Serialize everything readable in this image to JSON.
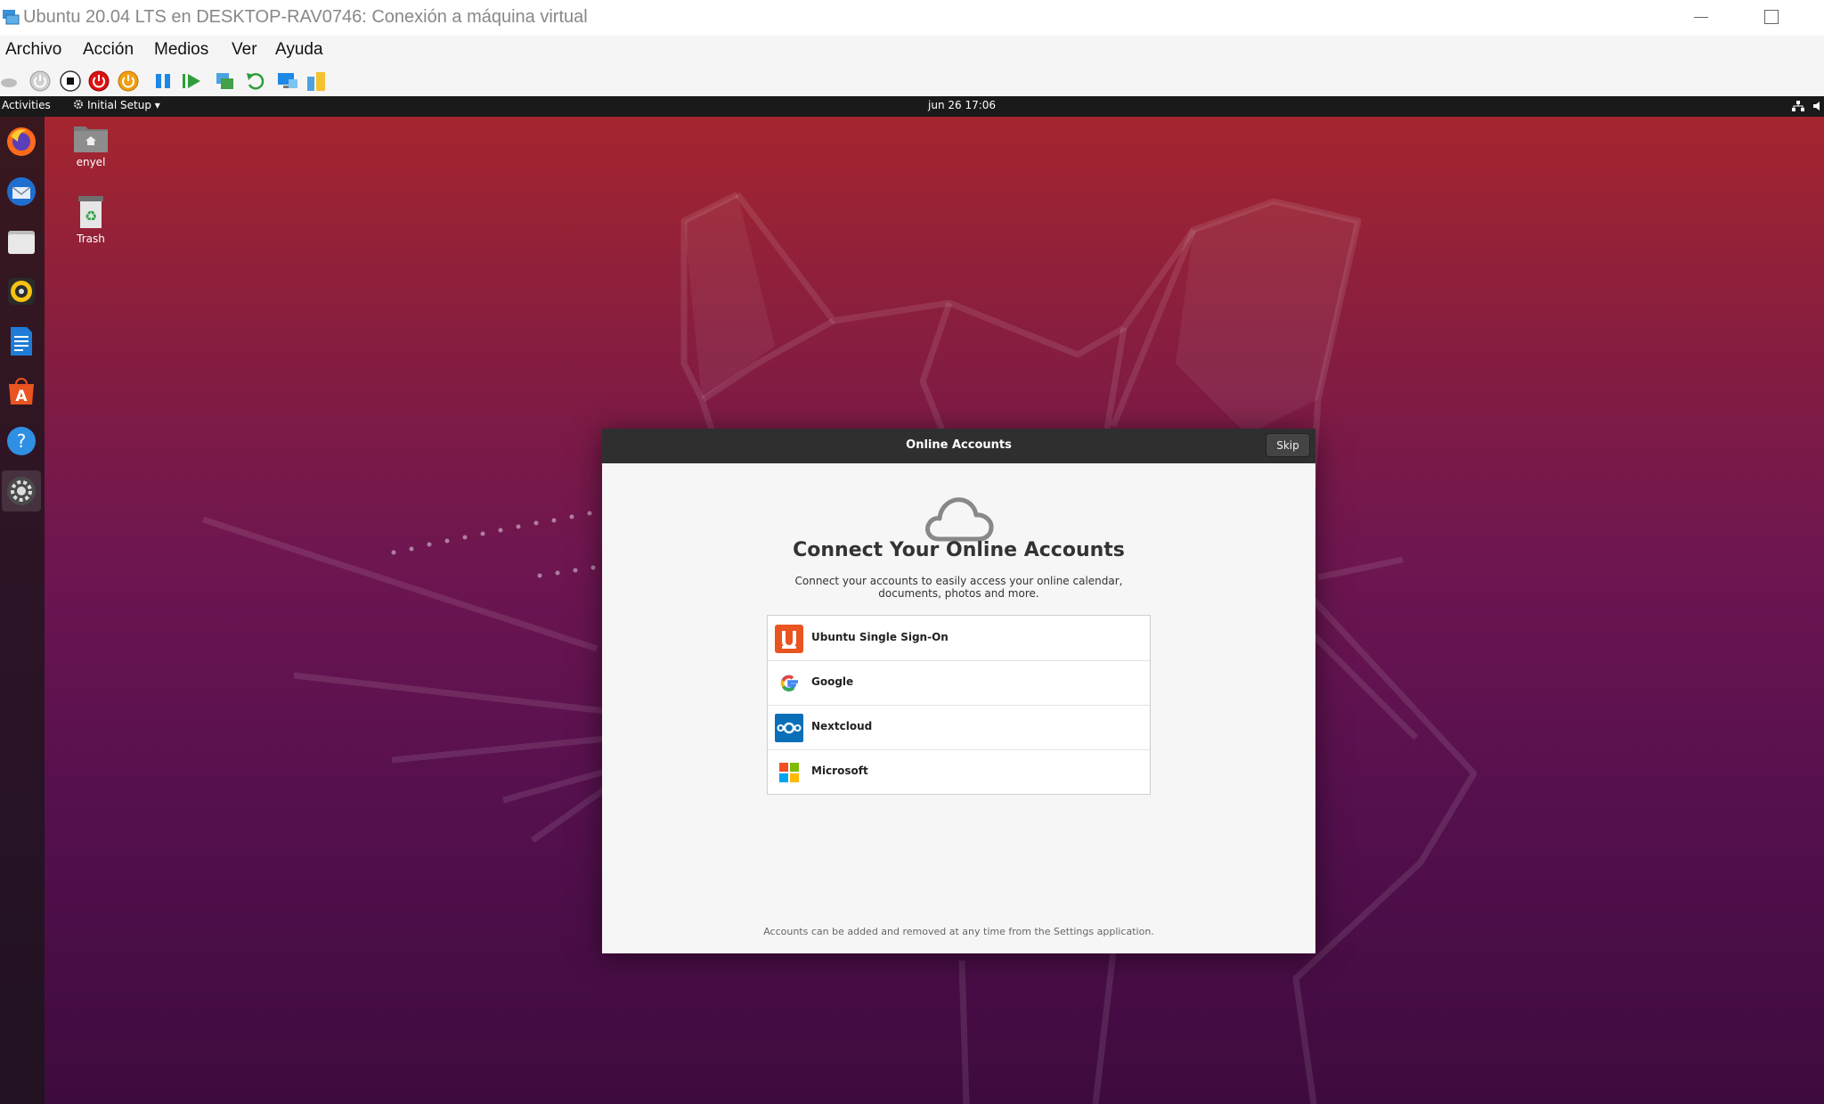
{
  "host": {
    "title": "Ubuntu 20.04 LTS en DESKTOP-RAV0746: Conexión a máquina virtual",
    "menu": [
      "Archivo",
      "Acción",
      "Medios",
      "Ver",
      "Ayuda"
    ],
    "toolbar_icons": [
      "ctrl-alt-del-icon",
      "start-icon",
      "turn-off-icon",
      "shut-down-icon",
      "save-state-icon",
      "pause-icon",
      "resume-icon",
      "checkpoint-icon",
      "revert-icon",
      "enhanced-session-icon",
      "share-icon"
    ]
  },
  "guest": {
    "topbar": {
      "activities": "Activities",
      "app_menu": "Initial Setup",
      "clock": "jun 26  17:06"
    },
    "dock": [
      "firefox-icon",
      "thunderbird-icon",
      "files-icon",
      "rhythmbox-icon",
      "libreoffice-writer-icon",
      "ubuntu-software-icon",
      "help-icon",
      "settings-icon"
    ],
    "desktop_icons": [
      {
        "label": "enyel",
        "icon": "home-folder-icon"
      },
      {
        "label": "Trash",
        "icon": "trash-icon"
      }
    ],
    "dialog": {
      "title": "Online Accounts",
      "skip": "Skip",
      "heading": "Connect Your Online Accounts",
      "description": "Connect your accounts to easily access your online calendar, documents, photos and more.",
      "providers": [
        {
          "label": "Ubuntu Single Sign-On",
          "icon": "ubuntu-sso-icon"
        },
        {
          "label": "Google",
          "icon": "google-icon"
        },
        {
          "label": "Nextcloud",
          "icon": "nextcloud-icon"
        },
        {
          "label": "Microsoft",
          "icon": "microsoft-icon"
        }
      ],
      "footer": "Accounts can be added and removed at any time from the Settings application."
    }
  }
}
